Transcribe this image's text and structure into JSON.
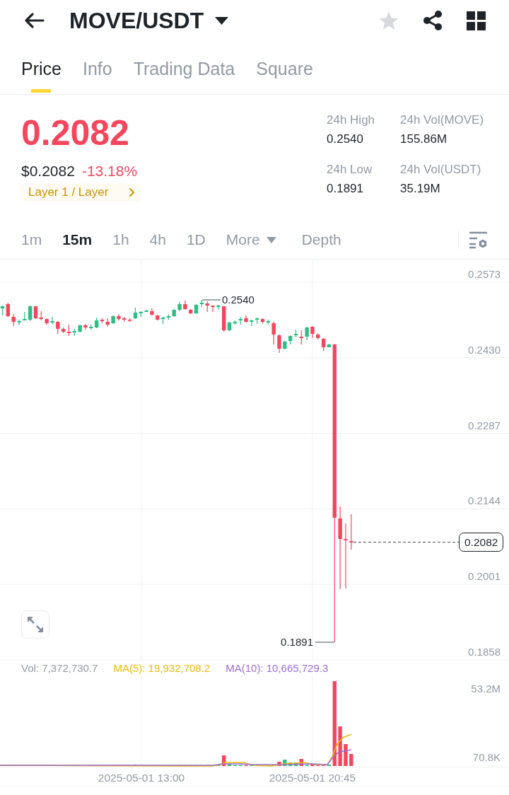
{
  "header": {
    "title": "MOVE/USDT",
    "favorite": false
  },
  "tabs": [
    {
      "label": "Price",
      "selected": true
    },
    {
      "label": "Info",
      "selected": false
    },
    {
      "label": "Trading Data",
      "selected": false
    },
    {
      "label": "Square",
      "selected": false
    }
  ],
  "ticker": {
    "price": "0.2082",
    "fiat_price": "$0.2082",
    "change": "-13.18%",
    "category": "Layer 1 / Layer",
    "stats": [
      {
        "label": "24h High",
        "value": "0.2540"
      },
      {
        "label": "24h Vol(MOVE)",
        "value": "155.86M"
      },
      {
        "label": "24h Low",
        "value": "0.1891"
      },
      {
        "label": "24h Vol(USDT)",
        "value": "35.19M"
      }
    ]
  },
  "intervals": [
    {
      "label": "1m",
      "kind": "interval",
      "selected": false
    },
    {
      "label": "15m",
      "kind": "interval",
      "selected": true
    },
    {
      "label": "1h",
      "kind": "interval",
      "selected": false
    },
    {
      "label": "4h",
      "kind": "interval",
      "selected": false
    },
    {
      "label": "1D",
      "kind": "interval",
      "selected": false
    },
    {
      "label": "More",
      "kind": "dropdown",
      "selected": false
    },
    {
      "label": "Depth",
      "kind": "view",
      "selected": false
    }
  ],
  "chart": {
    "price_axis": [
      "0.2573",
      "0.2430",
      "0.2287",
      "0.2144",
      "0.2001",
      "0.1858"
    ],
    "high_label": "0.2540",
    "low_label": "0.1891",
    "last_price": "0.2082",
    "volume_legend": [
      {
        "label": "Vol: 7,372,730.7",
        "color": "#929aa5"
      },
      {
        "label": "MA(5): 19,932,708.2",
        "color": "#f0b90b"
      },
      {
        "label": "MA(10): 10,665,729.3",
        "color": "#9b6fd1"
      }
    ],
    "volume_axis": [
      "53.2M",
      "70.8K"
    ],
    "time_axis": [
      "2025-05-01 13:00",
      "2025-05-01 20:45"
    ]
  }
}
